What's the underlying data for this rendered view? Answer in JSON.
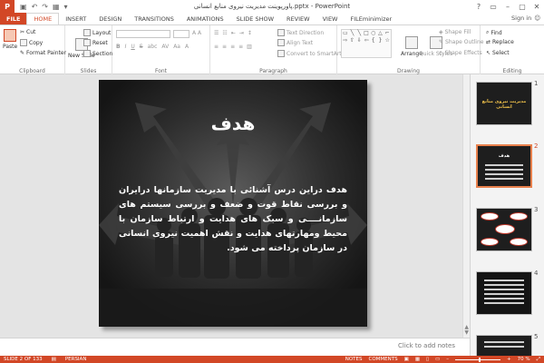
{
  "titlebar": {
    "title": "پاورپوینت مدیریت نیروی منابع انسانی.pptx - PowerPoint",
    "app_icon": "P",
    "controls": [
      "?",
      "▭",
      "–",
      "▢",
      "✕"
    ]
  },
  "tabs": {
    "file": "FILE",
    "items": [
      "HOME",
      "INSERT",
      "DESIGN",
      "TRANSITIONS",
      "ANIMATIONS",
      "SLIDE SHOW",
      "REVIEW",
      "VIEW",
      "FILEminimizer"
    ],
    "active": "HOME",
    "sign_in": "Sign in"
  },
  "ribbon": {
    "clipboard": {
      "label": "Clipboard",
      "paste": "Paste",
      "cut": "Cut",
      "copy": "Copy",
      "format_painter": "Format Painter"
    },
    "slides": {
      "label": "Slides",
      "new_slide": "New Slide",
      "layout": "Layout",
      "reset": "Reset",
      "section": "Section"
    },
    "font": {
      "label": "Font"
    },
    "paragraph": {
      "label": "Paragraph",
      "text_direction": "Text Direction",
      "align_text": "Align Text",
      "convert_smartart": "Convert to SmartArt"
    },
    "drawing": {
      "label": "Drawing",
      "arrange": "Arrange",
      "quick_styles": "Quick Styles",
      "shape_fill": "Shape Fill",
      "shape_outline": "Shape Outline",
      "shape_effects": "Shape Effects"
    },
    "editing": {
      "label": "Editing",
      "find": "Find",
      "replace": "Replace",
      "select": "Select"
    }
  },
  "slide": {
    "title": "هدف",
    "body": "هدف دراین درس آشنائی با مدیریت سازمانها درایران و بررسی نقاط قوت و ضعف و بررسی سیستم های سازمانــــی و سبک های هدایت و ارتباط سازمان با محیط ومهارتهای هدایت و نقش اهمیت نیروی انسانی در سازمان پرداخته می شود."
  },
  "notes": {
    "placeholder": "Click to add notes"
  },
  "thumbnails": {
    "items": [
      {
        "num": "1",
        "title": "مدیریت نیروی منابع انسانی"
      },
      {
        "num": "2",
        "title": "هدف"
      },
      {
        "num": "3",
        "title": ""
      },
      {
        "num": "4",
        "title": ""
      },
      {
        "num": "5",
        "title": ""
      }
    ],
    "selected_index": 1
  },
  "status": {
    "slide": "SLIDE 2 OF 133",
    "language": "PERSIAN",
    "notes": "NOTES",
    "comments": "COMMENTS",
    "zoom": "70 %"
  },
  "colors": {
    "accent": "#d24726",
    "slide_bg": "#1d1d1d",
    "thumb_title": "#f1c24a"
  }
}
